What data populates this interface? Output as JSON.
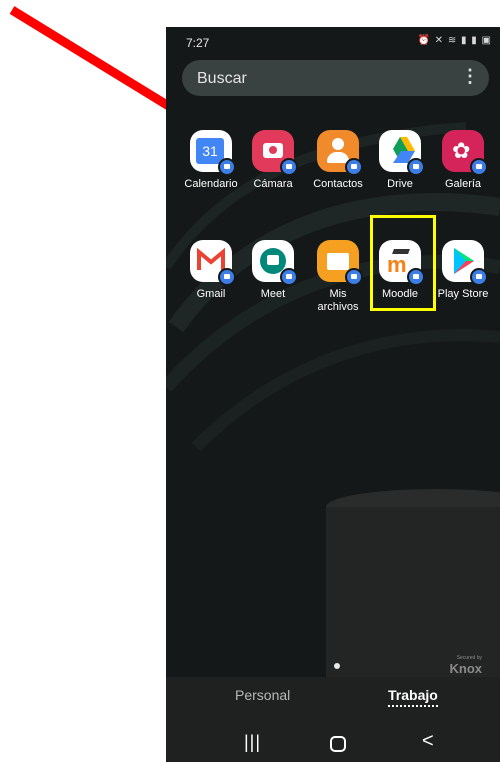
{
  "statusbar": {
    "time": "7:27",
    "icons": "⏰ ✕ ≋ ▮ ▮ ▣"
  },
  "search": {
    "placeholder": "Buscar",
    "more_icon": "⋮"
  },
  "apps": [
    {
      "label": "Calendario",
      "icon": "calendar-icon",
      "number": "31"
    },
    {
      "label": "Cámara",
      "icon": "camera-icon"
    },
    {
      "label": "Contactos",
      "icon": "contacts-icon"
    },
    {
      "label": "Drive",
      "icon": "drive-icon"
    },
    {
      "label": "Galería",
      "icon": "gallery-icon"
    },
    {
      "label": "Gmail",
      "icon": "gmail-icon"
    },
    {
      "label": "Meet",
      "icon": "meet-icon"
    },
    {
      "label": "Mis\narchivos",
      "icon": "files-icon"
    },
    {
      "label": "Moodle",
      "icon": "moodle-icon"
    },
    {
      "label": "Play Store",
      "icon": "playstore-icon"
    }
  ],
  "knox": {
    "secured_by": "Secured by",
    "brand": "Knox"
  },
  "tabs": {
    "personal": "Personal",
    "work": "Trabajo"
  },
  "navbar": {
    "recents": "|||",
    "back": "<"
  },
  "colors": {
    "highlight": "#ffff00",
    "arrow": "#ff0000",
    "badge": "#3d7de6"
  }
}
